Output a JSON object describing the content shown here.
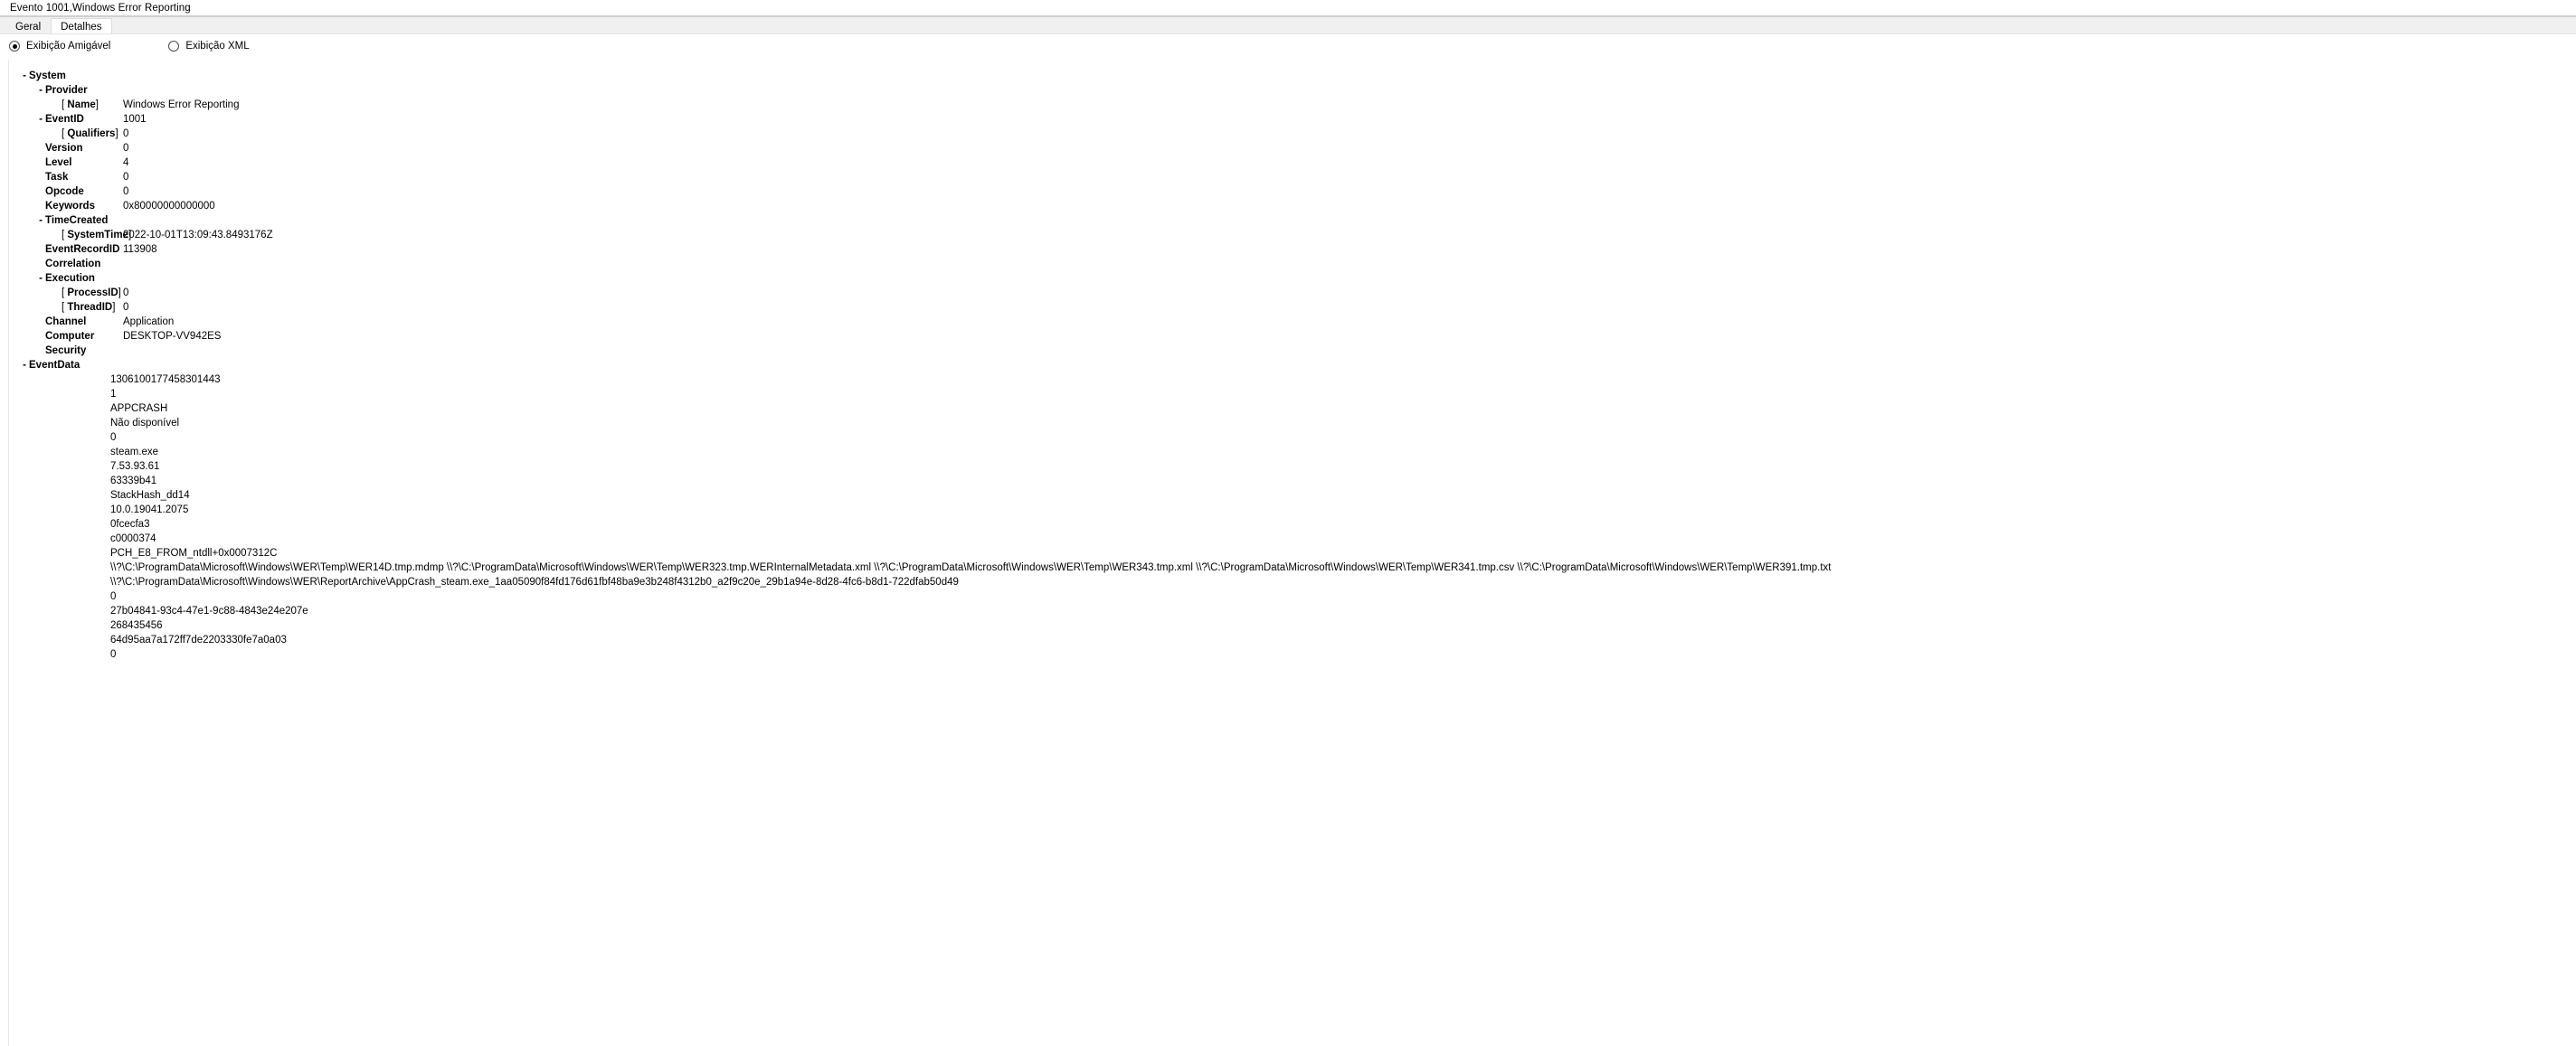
{
  "window": {
    "title": "Evento 1001,Windows Error Reporting"
  },
  "tabs": [
    {
      "label": "Geral",
      "active": false
    },
    {
      "label": "Detalhes",
      "active": true
    }
  ],
  "view_options": [
    {
      "label": "Exibição Amigável",
      "selected": true
    },
    {
      "label": "Exibição XML",
      "selected": false
    }
  ],
  "system": {
    "label": "System",
    "provider": {
      "label": "Provider",
      "name_attr": "Name",
      "name_value": "Windows Error Reporting"
    },
    "event_id": {
      "label": "EventID",
      "value": "1001"
    },
    "qualifiers": {
      "label": "Qualifiers",
      "value": "0"
    },
    "version": {
      "label": "Version",
      "value": "0"
    },
    "level": {
      "label": "Level",
      "value": "4"
    },
    "task": {
      "label": "Task",
      "value": "0"
    },
    "opcode": {
      "label": "Opcode",
      "value": "0"
    },
    "keywords": {
      "label": "Keywords",
      "value": "0x80000000000000"
    },
    "time_created": {
      "label": "TimeCreated",
      "attr": "SystemTime",
      "value": "2022-10-01T13:09:43.8493176Z"
    },
    "event_record_id": {
      "label": "EventRecordID",
      "value": "113908"
    },
    "correlation": {
      "label": "Correlation",
      "value": ""
    },
    "execution": {
      "label": "Execution",
      "process_id_attr": "ProcessID",
      "process_id_value": "0",
      "thread_id_attr": "ThreadID",
      "thread_id_value": "0"
    },
    "channel": {
      "label": "Channel",
      "value": "Application"
    },
    "computer": {
      "label": "Computer",
      "value": "DESKTOP-VV942ES"
    },
    "security": {
      "label": "Security",
      "value": ""
    }
  },
  "event_data": {
    "label": "EventData",
    "values": [
      "1306100177458301443",
      "1",
      "APPCRASH",
      "Não disponível",
      "0",
      "steam.exe",
      "7.53.93.61",
      "63339b41",
      "StackHash_dd14",
      "10.0.19041.2075",
      "0fcecfa3",
      "c0000374",
      "PCH_E8_FROM_ntdll+0x0007312C",
      "\\\\?\\C:\\ProgramData\\Microsoft\\Windows\\WER\\Temp\\WER14D.tmp.mdmp \\\\?\\C:\\ProgramData\\Microsoft\\Windows\\WER\\Temp\\WER323.tmp.WERInternalMetadata.xml \\\\?\\C:\\ProgramData\\Microsoft\\Windows\\WER\\Temp\\WER343.tmp.xml \\\\?\\C:\\ProgramData\\Microsoft\\Windows\\WER\\Temp\\WER341.tmp.csv \\\\?\\C:\\ProgramData\\Microsoft\\Windows\\WER\\Temp\\WER391.tmp.txt",
      "\\\\?\\C:\\ProgramData\\Microsoft\\Windows\\WER\\ReportArchive\\AppCrash_steam.exe_1aa05090f84fd176d61fbf48ba9e3b248f4312b0_a2f9c20e_29b1a94e-8d28-4fc6-b8d1-722dfab50d49",
      "0",
      "27b04841-93c4-47e1-9c88-4843e24e207e",
      "268435456",
      "64d95aa7a172ff7de2203330fe7a0a03",
      "0"
    ]
  },
  "icons": {
    "expander_expanded": "-"
  }
}
